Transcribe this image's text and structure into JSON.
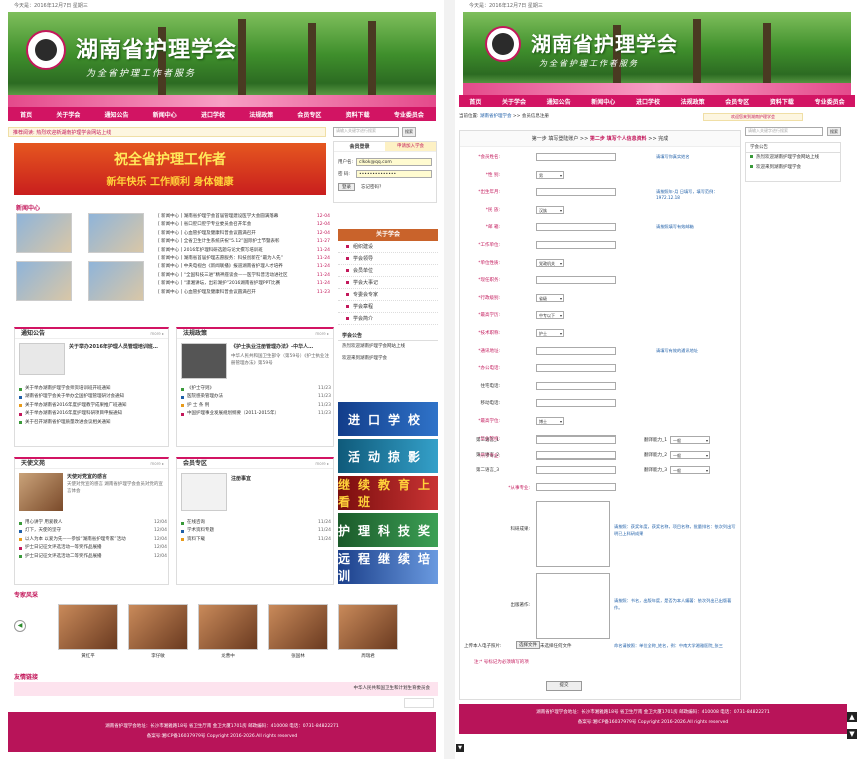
{
  "common": {
    "date_text": "今天是：2016年12月7日 星期三",
    "site_title": "湖南省护理学会",
    "site_slogan": "为全省护理工作者服务",
    "nav": [
      "首页",
      "关于学会",
      "通知公告",
      "新闻中心",
      "进口学校",
      "法规政策",
      "会员专区",
      "资料下载",
      "专业委员会"
    ],
    "footer_line1": "湖南省护理学会地址：长沙市湘雅路18号 省卫生厅南 金卫大厦1701房 邮政编码：410008 电话：0731-84822271",
    "footer_line2": "备案号:湘ICP备16037979号 Copyright 2016-2026.All rights reserved"
  },
  "left": {
    "notice": "推荐阅读: 热烈欢迎新湖南护理学会网站上线",
    "search_placeholder": "请输入关键字进行搜索",
    "search_button": "搜索",
    "slide_text": "祝全省护理工作者",
    "slide_sub": "新年快乐 工作顺利 身体健康",
    "login": {
      "tab_member": "会员登录",
      "tab_join": "申请加入学会",
      "user_label": "用户名:",
      "user_value": "clkok@qq.com",
      "pwd_label": "密  码:",
      "pwd_value": "••••••••••••••",
      "login_button": "登录",
      "forgot": "忘记密码？"
    },
    "news_title": "新闻中心",
    "news": [
      {
        "t": "[ 新闻中心 ] 湖南省护理学会首届管理建设医学大会圆满落幕",
        "d": "12-04"
      },
      {
        "t": "[ 新闻中心 ] 省口腔口腔学专业委员会召开年会",
        "d": "12-04"
      },
      {
        "t": "[ 新闻中心 ] 心血管护理及健康科普会议圆满召开",
        "d": "12-04"
      },
      {
        "t": "[ 新闻中心 ] 全省卫生计生系统庆祝“5.12”国际护士节暨表彰",
        "d": "11-27"
      },
      {
        "t": "[ 新闻中心 ] 2016年护理科研选题与论文撰写培训班",
        "d": "11-24"
      },
      {
        "t": "[ 新闻中心 ] 湖南省首届护理志愿服务：科技创新在“最为人先”",
        "d": "11-24"
      },
      {
        "t": "[ 新闻中心 ] 中央电视台《新闻联播》报道湖南省护理人才培养",
        "d": "11-24"
      },
      {
        "t": "[ 新闻中心 ] “全国科技三进”精神座谈会——医学科普活动进社区",
        "d": "11-24"
      },
      {
        "t": "[ 新闻中心 ] “潇湘讲坛，出彩湖护”2016湖南省护理PPT比赛",
        "d": "11-24"
      },
      {
        "t": "[ 新闻中心 ] 心血管护理及健康科普会议圆满召开",
        "d": "11-23"
      }
    ],
    "about_title": "关于学会",
    "about_items": [
      "组织建设",
      "学会领导",
      "会员单位",
      "学会大事记",
      "专委会专家",
      "学会章程",
      "学会简介"
    ],
    "gonggao_title": "学会公告",
    "gonggao_items": [
      "热烈欢迎湖南护理学会网站上线",
      "欢迎来到湖南护理学会"
    ],
    "notice_box": {
      "title": "通知公告",
      "headline": "关于举办2016年护理人员管理培训班…",
      "items": [
        {
          "t": "关于举办湖南护理学会师资培训班开班通知"
        },
        {
          "t": "湖南省护理学会关于举办全国护理管理研讨会通知"
        },
        {
          "t": "关于举办湖南省2016年度护理教学成果推广班通知"
        },
        {
          "t": "关于举办湖南省2016年度护理科研项目申报通知"
        },
        {
          "t": "关于召开湖南省护理质量改进会议相关通知"
        }
      ]
    },
    "law_box": {
      "title": "法规政策",
      "headline": "《护士执业注册管理办法》-中华人…",
      "desc": "中华人民共和国卫生部令（第59号）《护士执业注册管理办法》第59号",
      "items": [
        {
          "t": "《护士守则》",
          "d": "11/23"
        },
        {
          "t": "医院感染管理办法",
          "d": "11/23"
        },
        {
          "t": "护  士  条  例",
          "d": "11/23"
        },
        {
          "t": "中国护理事业发展规划纲要（2011-2015年）",
          "d": "11/23"
        }
      ]
    },
    "culture_box": {
      "title": "天使文苑",
      "headline": "天使对党宣的感言",
      "desc": "天使对党宣的感言 湖南省护理学会会员对党的宣言体会",
      "items": [
        {
          "t": "用心讲学 用爱教人",
          "d": "12/04"
        },
        {
          "t": "灯下，天使的坚守",
          "d": "12/04"
        },
        {
          "t": "以人为本 以爱为先——参加“湖南省护理专家”活动",
          "d": "12/04"
        },
        {
          "t": "护士日记征文评选活动一等奖作品展播",
          "d": "12/04"
        },
        {
          "t": "护士日记征文评选活动二等奖作品展播",
          "d": "12/04"
        }
      ]
    },
    "member_box": {
      "title": "会员专区",
      "headline": "注册事宜",
      "items": [
        {
          "t": "在线咨询",
          "d": "11/24"
        },
        {
          "t": "学术资料专题",
          "d": "11/24"
        },
        {
          "t": "资料下载",
          "d": "11/24"
        }
      ]
    },
    "ads": [
      "进口学校",
      "活动掠影",
      "继续教育上看班",
      "护理科技奖",
      "远程继续培训"
    ],
    "experts_title": "专家风采",
    "experts": [
      "黄红平",
      "李仔敏",
      "龙曹中",
      "张国林",
      "周瑞君"
    ],
    "links_title": "友情链接",
    "links_marquee": "中华人民共和国卫生和计划生育委员会"
  },
  "right": {
    "breadcrumb_prefix": "当前位置:",
    "breadcrumb_link": "湖南省护理学会",
    "breadcrumb_rest": ">> 会员信息注册",
    "right_notice": "欢迎您来到湖南护理学会",
    "steps": [
      "第一步 填写登陆账户",
      ">>",
      "第二步 填写个人信息资料",
      ">>",
      "完成"
    ],
    "search_placeholder": "请输入关键字进行搜索",
    "search_button": "搜索",
    "side_title": "学会公告",
    "side_items": [
      "热烈欢迎湖南护理学会网站上线",
      "欢迎来到湖南护理学会"
    ],
    "fields": [
      {
        "label": "*会员姓名:",
        "type": "input",
        "hint": "请填写你真实姓名"
      },
      {
        "label": "*性      别:",
        "type": "select",
        "value": "男"
      },
      {
        "label": "*出生年月:",
        "type": "input",
        "hint": "请按照年-月 日填写，填写范例：1972.12.18"
      },
      {
        "label": "*民      族:",
        "type": "select",
        "value": "汉族"
      },
      {
        "label": "*邮      箱:",
        "type": "input",
        "hint": "请按照填写有效邮箱"
      },
      {
        "label": "*工作单位:",
        "type": "input"
      },
      {
        "label": "*单位性质:",
        "type": "select",
        "value": "党政机关"
      },
      {
        "label": "*现任职务:",
        "type": "input"
      },
      {
        "label": "*行政级别:",
        "type": "select",
        "value": "省级"
      },
      {
        "label": "*最高学历:",
        "type": "select",
        "value": "中专以下"
      },
      {
        "label": "*技术职称:",
        "type": "select",
        "value": "护士"
      },
      {
        "label": "*通讯地址:",
        "type": "input",
        "hint": "请填写有效的通讯地址"
      },
      {
        "label": "*办公电话:",
        "type": "input"
      },
      {
        "label": "住宅电话:",
        "type": "input"
      },
      {
        "label": "移动电话:",
        "type": "input"
      },
      {
        "label": "*最高学位:",
        "type": "select",
        "value": "博士"
      },
      {
        "label": "*毕业院校:",
        "type": "input"
      },
      {
        "label": "*所学专业:",
        "type": "input"
      }
    ],
    "langs": [
      {
        "label": "第二语言_1",
        "level_label": "翻译能力_1",
        "level": "一般"
      },
      {
        "label": "第二语言_2",
        "level_label": "翻译能力_2",
        "level": "一般"
      },
      {
        "label": "第二语言_3",
        "level_label": "翻译能力_3",
        "level": "一般"
      }
    ],
    "specialty_label": "*从事专业:",
    "research_label": "科研成果:",
    "research_hint": "请按照：获奖年度，获奖名称，项目名称，批量排名：依次列出写明已上科研成果",
    "paper_label": "出版著作:",
    "paper_hint": "请按照：书名，出版年度，是否为本人编著：依次列出已出版著作。",
    "upload_label": "上传本人电子照片:",
    "upload_button": "选择文件",
    "upload_status": "未选择任何文件",
    "upload_hint": "命名请按照：单位全称_姓名，例：中南大学湘雅医院_张三",
    "agree_text": "注:* 号标记为必须填写的项",
    "submit": "提交"
  }
}
